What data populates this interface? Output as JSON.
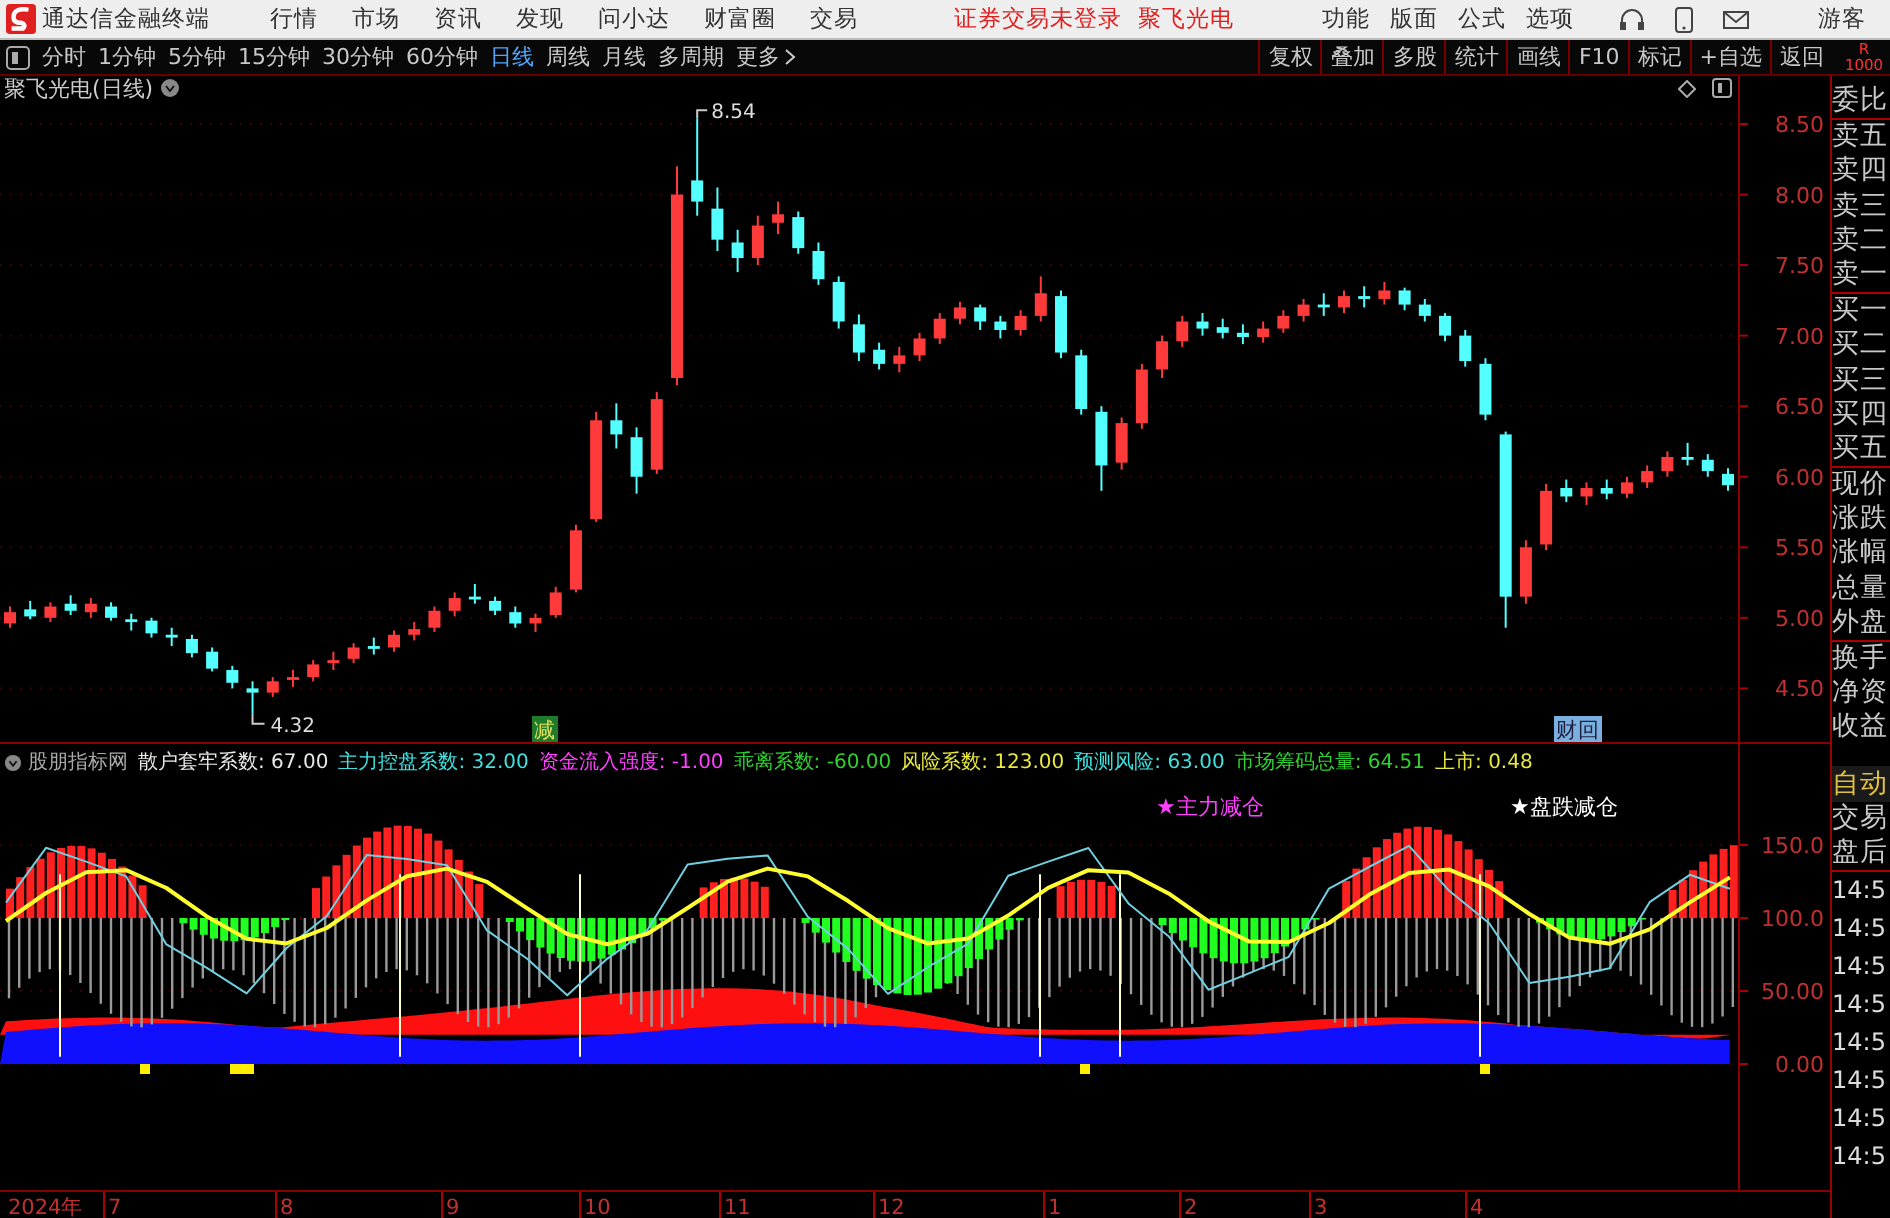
{
  "menu_bar": {
    "app_title": "通达信金融终端",
    "items": [
      "行情",
      "市场",
      "资讯",
      "发现",
      "问小达",
      "财富圈",
      "交易"
    ],
    "login_status": "证券交易未登录",
    "stock_name": "聚飞光电",
    "right_items": [
      "功能",
      "版面",
      "公式",
      "选项"
    ],
    "user": "游客"
  },
  "toolbar": {
    "periods": [
      {
        "label": "分时",
        "selected": false
      },
      {
        "label": "1分钟",
        "selected": false
      },
      {
        "label": "5分钟",
        "selected": false
      },
      {
        "label": "15分钟",
        "selected": false
      },
      {
        "label": "30分钟",
        "selected": false
      },
      {
        "label": "60分钟",
        "selected": false
      },
      {
        "label": "日线",
        "selected": true
      },
      {
        "label": "周线",
        "selected": false
      },
      {
        "label": "月线",
        "selected": false
      },
      {
        "label": "多周期",
        "selected": false
      }
    ],
    "more": "更多",
    "actions": [
      "复权",
      "叠加",
      "多股",
      "统计",
      "画线",
      "F10",
      "标记",
      "+自选",
      "返回"
    ],
    "badge_letter": "R",
    "badge_number": "1000"
  },
  "main_chart": {
    "title": "聚飞光电(日线)",
    "high_label": "8.54",
    "low_label": "4.32",
    "markers": [
      {
        "text": "减",
        "kind": "reduce"
      },
      {
        "text": "财回",
        "kind": "finance"
      }
    ],
    "chart_data": {
      "type": "candlestick",
      "ylim": [
        4.12,
        8.84
      ],
      "grid": true,
      "yticks": [
        {
          "value": 8.5,
          "label": "8.50"
        },
        {
          "value": 8,
          "label": "8.00"
        },
        {
          "value": 7.5,
          "label": "7.50"
        },
        {
          "value": 7,
          "label": "7.00"
        },
        {
          "value": 6.5,
          "label": "6.50"
        },
        {
          "value": 6,
          "label": "6.00"
        },
        {
          "value": 5.5,
          "label": "5.50"
        },
        {
          "value": 5,
          "label": "5.00"
        },
        {
          "value": 4.5,
          "label": "4.50"
        }
      ],
      "ohlc": [
        [
          4.96,
          5.08,
          4.93,
          5.04
        ],
        [
          5.06,
          5.12,
          4.99,
          5.01
        ],
        [
          5.0,
          5.11,
          4.97,
          5.08
        ],
        [
          5.1,
          5.16,
          5.02,
          5.05
        ],
        [
          5.04,
          5.14,
          5.0,
          5.1
        ],
        [
          5.08,
          5.11,
          4.98,
          5.0
        ],
        [
          4.99,
          5.03,
          4.91,
          4.97
        ],
        [
          4.98,
          5.0,
          4.86,
          4.89
        ],
        [
          4.88,
          4.93,
          4.8,
          4.86
        ],
        [
          4.85,
          4.88,
          4.72,
          4.75
        ],
        [
          4.76,
          4.79,
          4.62,
          4.64
        ],
        [
          4.63,
          4.66,
          4.5,
          4.54
        ],
        [
          4.5,
          4.55,
          4.32,
          4.47
        ],
        [
          4.47,
          4.58,
          4.44,
          4.55
        ],
        [
          4.56,
          4.63,
          4.51,
          4.58
        ],
        [
          4.58,
          4.7,
          4.55,
          4.67
        ],
        [
          4.68,
          4.76,
          4.63,
          4.7
        ],
        [
          4.71,
          4.82,
          4.68,
          4.79
        ],
        [
          4.8,
          4.86,
          4.74,
          4.78
        ],
        [
          4.79,
          4.91,
          4.76,
          4.88
        ],
        [
          4.88,
          4.97,
          4.84,
          4.92
        ],
        [
          4.93,
          5.08,
          4.9,
          5.05
        ],
        [
          5.05,
          5.18,
          5.01,
          5.14
        ],
        [
          5.15,
          5.24,
          5.1,
          5.13
        ],
        [
          5.12,
          5.15,
          5.02,
          5.05
        ],
        [
          5.04,
          5.08,
          4.93,
          4.96
        ],
        [
          4.96,
          5.03,
          4.9,
          5.0
        ],
        [
          5.02,
          5.22,
          5.0,
          5.18
        ],
        [
          5.2,
          5.66,
          5.18,
          5.62
        ],
        [
          5.7,
          6.46,
          5.68,
          6.4
        ],
        [
          6.4,
          6.52,
          6.2,
          6.3
        ],
        [
          6.28,
          6.35,
          5.88,
          6.0
        ],
        [
          6.05,
          6.6,
          6.02,
          6.55
        ],
        [
          6.7,
          8.2,
          6.65,
          8.0
        ],
        [
          8.1,
          8.54,
          7.85,
          7.95
        ],
        [
          7.9,
          8.05,
          7.6,
          7.68
        ],
        [
          7.66,
          7.75,
          7.45,
          7.55
        ],
        [
          7.55,
          7.85,
          7.5,
          7.78
        ],
        [
          7.8,
          7.95,
          7.72,
          7.86
        ],
        [
          7.84,
          7.88,
          7.58,
          7.62
        ],
        [
          7.6,
          7.66,
          7.36,
          7.4
        ],
        [
          7.38,
          7.42,
          7.05,
          7.1
        ],
        [
          7.08,
          7.15,
          6.82,
          6.88
        ],
        [
          6.9,
          6.95,
          6.76,
          6.8
        ],
        [
          6.8,
          6.92,
          6.74,
          6.86
        ],
        [
          6.86,
          7.02,
          6.82,
          6.98
        ],
        [
          6.98,
          7.16,
          6.94,
          7.12
        ],
        [
          7.12,
          7.24,
          7.08,
          7.2
        ],
        [
          7.2,
          7.22,
          7.04,
          7.1
        ],
        [
          7.1,
          7.14,
          6.98,
          7.04
        ],
        [
          7.04,
          7.18,
          7.0,
          7.14
        ],
        [
          7.14,
          7.42,
          7.1,
          7.3
        ],
        [
          7.28,
          7.32,
          6.84,
          6.88
        ],
        [
          6.86,
          6.9,
          6.44,
          6.48
        ],
        [
          6.46,
          6.5,
          5.9,
          6.08
        ],
        [
          6.1,
          6.42,
          6.05,
          6.38
        ],
        [
          6.38,
          6.8,
          6.34,
          6.76
        ],
        [
          6.76,
          7.0,
          6.7,
          6.96
        ],
        [
          6.96,
          7.14,
          6.92,
          7.1
        ],
        [
          7.1,
          7.16,
          7.0,
          7.05
        ],
        [
          7.06,
          7.12,
          6.98,
          7.02
        ],
        [
          7.02,
          7.08,
          6.94,
          6.99
        ],
        [
          6.99,
          7.1,
          6.95,
          7.05
        ],
        [
          7.05,
          7.18,
          7.02,
          7.14
        ],
        [
          7.14,
          7.26,
          7.1,
          7.22
        ],
        [
          7.22,
          7.3,
          7.14,
          7.2
        ],
        [
          7.2,
          7.32,
          7.16,
          7.28
        ],
        [
          7.28,
          7.35,
          7.2,
          7.26
        ],
        [
          7.26,
          7.38,
          7.22,
          7.32
        ],
        [
          7.32,
          7.34,
          7.18,
          7.22
        ],
        [
          7.22,
          7.26,
          7.1,
          7.14
        ],
        [
          7.14,
          7.16,
          6.96,
          7.0
        ],
        [
          7.0,
          7.04,
          6.78,
          6.82
        ],
        [
          6.8,
          6.84,
          6.4,
          6.44
        ],
        [
          6.3,
          6.32,
          4.93,
          5.15
        ],
        [
          5.15,
          5.55,
          5.1,
          5.5
        ],
        [
          5.52,
          5.95,
          5.48,
          5.9
        ],
        [
          5.92,
          5.98,
          5.82,
          5.86
        ],
        [
          5.86,
          5.96,
          5.8,
          5.92
        ],
        [
          5.92,
          5.98,
          5.84,
          5.88
        ],
        [
          5.88,
          6.0,
          5.85,
          5.96
        ],
        [
          5.96,
          6.08,
          5.92,
          6.04
        ],
        [
          6.04,
          6.18,
          6.0,
          6.14
        ],
        [
          6.14,
          6.24,
          6.08,
          6.12
        ],
        [
          6.12,
          6.16,
          6.0,
          6.04
        ],
        [
          6.02,
          6.06,
          5.9,
          5.94
        ]
      ]
    }
  },
  "indicator": {
    "source": "股朋指标网",
    "values": [
      {
        "text": "散户套牢系数: 67.00",
        "color": "#e8e8e8"
      },
      {
        "text": "主力控盘系数: 32.00",
        "color": "#40e0e0"
      },
      {
        "text": "资金流入强度: -1.00",
        "color": "#ff40ff"
      },
      {
        "text": "乖离系数: -60.00",
        "color": "#30d030"
      },
      {
        "text": "风险系数: 123.00",
        "color": "#e8e840"
      },
      {
        "text": "预测风险: 63.00",
        "color": "#40e0e0"
      },
      {
        "text": "市场筹码总量: 64.51",
        "color": "#30d030"
      },
      {
        "text": "上市: 0.48",
        "color": "#e8e840"
      }
    ],
    "signals": [
      {
        "text": "★主力减仓",
        "color": "#ff40ff"
      },
      {
        "text": "★盘跌减仓",
        "color": "#ffffff"
      }
    ],
    "chart_data": {
      "type": "line",
      "ylim": [
        -86.3,
        219.2
      ],
      "grid": true,
      "yticks": [
        {
          "value": 150,
          "label": "150.0"
        },
        {
          "value": 100,
          "label": "100.0"
        },
        {
          "value": 50,
          "label": "50.00"
        },
        {
          "value": 0,
          "label": "0.00"
        }
      ],
      "series": [
        {
          "color": "#70d0e0",
          "values": [
            110.6,
            148.1,
            138.6,
            128.5,
            81.9,
            66.0,
            48.3,
            79.4,
            101.4,
            143.1,
            140.4,
            136.2,
            91.5,
            72.0,
            47.2,
            72.2,
            91.8,
            136.6,
            140.6,
            142.9,
            100.8,
            79.0,
            48.1,
            66.4,
            82.5,
            128.9,
            138.6,
            147.9,
            110.0,
            87.5,
            50.8,
            62.1,
            73.5,
            120.2,
            135.0,
            149.5,
            118.7,
            96.5,
            55.5,
            59.7,
            65.6,
            110.9,
            129.6,
            120.0
          ]
        },
        {
          "color": "#ffff30",
          "values": [
            97.9,
            117.2,
            131.4,
            132.8,
            120.5,
            101.3,
            85.8,
            82.6,
            93.2,
            112.1,
            128.6,
            133.8,
            124.8,
            106.6,
            89.1,
            82.0,
            89.2,
            106.8,
            125.0,
            133.9,
            128.5,
            111.8,
            93.0,
            82.5,
            86.0,
            101.6,
            120.7,
            132.8,
            131.3,
            116.9,
            97.7,
            84.0,
            83.6,
            96.6,
            115.9,
            130.8,
            133.1,
            121.7,
            102.7,
            86.6,
            82.3,
            92.2,
            110.7,
            127.8
          ]
        }
      ]
    }
  },
  "x_axis": {
    "labels": [
      "2024年",
      "7",
      "8",
      "9",
      "10",
      "11",
      "12",
      "1",
      "2",
      "3",
      "4"
    ]
  },
  "side_panel": {
    "quote_labels": [
      "委比",
      "卖五",
      "卖四",
      "卖三",
      "卖二",
      "卖一",
      "买一",
      "买二",
      "买三",
      "买四",
      "买五",
      "现价",
      "涨跌",
      "涨幅",
      "总量",
      "外盘",
      "换手",
      "净资",
      "收益"
    ],
    "mode": "自动",
    "tabs": [
      "交易",
      "盘后"
    ],
    "times": [
      "14:5",
      "14:5",
      "14:5",
      "14:5",
      "14:5",
      "14:5",
      "14:5",
      "14:5"
    ]
  }
}
